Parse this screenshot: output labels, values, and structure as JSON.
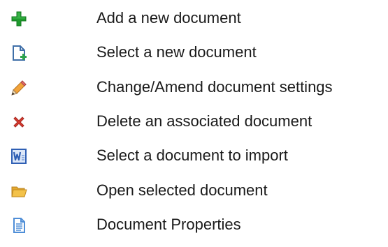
{
  "items": [
    {
      "icon": "add-icon",
      "label": "Add a new document"
    },
    {
      "icon": "new-document-icon",
      "label": "Select a new document"
    },
    {
      "icon": "pencil-icon",
      "label": "Change/Amend document settings"
    },
    {
      "icon": "delete-icon",
      "label": "Delete an associated document"
    },
    {
      "icon": "word-document-icon",
      "label": "Select a document to import"
    },
    {
      "icon": "folder-open-icon",
      "label": "Open selected document"
    },
    {
      "icon": "document-properties-icon",
      "label": "Document Properties"
    }
  ],
  "colors": {
    "add_green": "#1f9a2d",
    "new_doc_blue": "#3f6fa8",
    "new_doc_plus": "#2ca44a",
    "pencil_orange": "#f2a33a",
    "delete_red": "#d63a2f",
    "word_blue": "#2f5fb4",
    "folder_yellow": "#f3c24a",
    "properties_blue": "#4f8ed7"
  }
}
